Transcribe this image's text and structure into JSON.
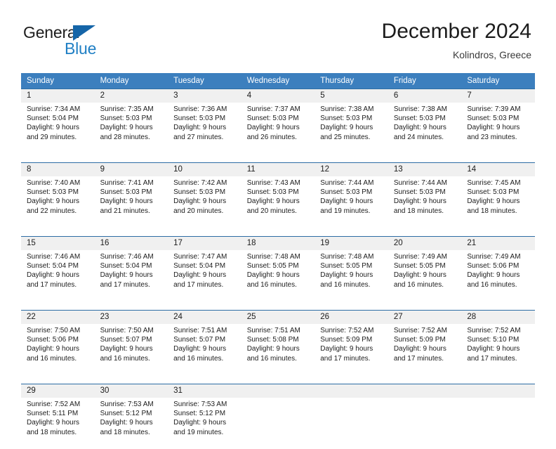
{
  "brand": {
    "name_part1": "General",
    "name_part2": "Blue",
    "triangle_color": "#1565a8",
    "blue_text_color": "#1f7fc4"
  },
  "header": {
    "title": "December 2024",
    "subtitle": "Kolindros, Greece"
  },
  "theme": {
    "header_bg": "#3c7fbe",
    "header_text": "#ffffff",
    "daynum_bg": "#f0f0f0",
    "row_border": "#2d6da4",
    "body_text": "#1c1c1c"
  },
  "weekday_headers": [
    "Sunday",
    "Monday",
    "Tuesday",
    "Wednesday",
    "Thursday",
    "Friday",
    "Saturday"
  ],
  "weeks": [
    {
      "days": [
        {
          "num": "1",
          "sunrise": "Sunrise: 7:34 AM",
          "sunset": "Sunset: 5:04 PM",
          "daylight1": "Daylight: 9 hours",
          "daylight2": "and 29 minutes."
        },
        {
          "num": "2",
          "sunrise": "Sunrise: 7:35 AM",
          "sunset": "Sunset: 5:03 PM",
          "daylight1": "Daylight: 9 hours",
          "daylight2": "and 28 minutes."
        },
        {
          "num": "3",
          "sunrise": "Sunrise: 7:36 AM",
          "sunset": "Sunset: 5:03 PM",
          "daylight1": "Daylight: 9 hours",
          "daylight2": "and 27 minutes."
        },
        {
          "num": "4",
          "sunrise": "Sunrise: 7:37 AM",
          "sunset": "Sunset: 5:03 PM",
          "daylight1": "Daylight: 9 hours",
          "daylight2": "and 26 minutes."
        },
        {
          "num": "5",
          "sunrise": "Sunrise: 7:38 AM",
          "sunset": "Sunset: 5:03 PM",
          "daylight1": "Daylight: 9 hours",
          "daylight2": "and 25 minutes."
        },
        {
          "num": "6",
          "sunrise": "Sunrise: 7:38 AM",
          "sunset": "Sunset: 5:03 PM",
          "daylight1": "Daylight: 9 hours",
          "daylight2": "and 24 minutes."
        },
        {
          "num": "7",
          "sunrise": "Sunrise: 7:39 AM",
          "sunset": "Sunset: 5:03 PM",
          "daylight1": "Daylight: 9 hours",
          "daylight2": "and 23 minutes."
        }
      ]
    },
    {
      "days": [
        {
          "num": "8",
          "sunrise": "Sunrise: 7:40 AM",
          "sunset": "Sunset: 5:03 PM",
          "daylight1": "Daylight: 9 hours",
          "daylight2": "and 22 minutes."
        },
        {
          "num": "9",
          "sunrise": "Sunrise: 7:41 AM",
          "sunset": "Sunset: 5:03 PM",
          "daylight1": "Daylight: 9 hours",
          "daylight2": "and 21 minutes."
        },
        {
          "num": "10",
          "sunrise": "Sunrise: 7:42 AM",
          "sunset": "Sunset: 5:03 PM",
          "daylight1": "Daylight: 9 hours",
          "daylight2": "and 20 minutes."
        },
        {
          "num": "11",
          "sunrise": "Sunrise: 7:43 AM",
          "sunset": "Sunset: 5:03 PM",
          "daylight1": "Daylight: 9 hours",
          "daylight2": "and 20 minutes."
        },
        {
          "num": "12",
          "sunrise": "Sunrise: 7:44 AM",
          "sunset": "Sunset: 5:03 PM",
          "daylight1": "Daylight: 9 hours",
          "daylight2": "and 19 minutes."
        },
        {
          "num": "13",
          "sunrise": "Sunrise: 7:44 AM",
          "sunset": "Sunset: 5:03 PM",
          "daylight1": "Daylight: 9 hours",
          "daylight2": "and 18 minutes."
        },
        {
          "num": "14",
          "sunrise": "Sunrise: 7:45 AM",
          "sunset": "Sunset: 5:03 PM",
          "daylight1": "Daylight: 9 hours",
          "daylight2": "and 18 minutes."
        }
      ]
    },
    {
      "days": [
        {
          "num": "15",
          "sunrise": "Sunrise: 7:46 AM",
          "sunset": "Sunset: 5:04 PM",
          "daylight1": "Daylight: 9 hours",
          "daylight2": "and 17 minutes."
        },
        {
          "num": "16",
          "sunrise": "Sunrise: 7:46 AM",
          "sunset": "Sunset: 5:04 PM",
          "daylight1": "Daylight: 9 hours",
          "daylight2": "and 17 minutes."
        },
        {
          "num": "17",
          "sunrise": "Sunrise: 7:47 AM",
          "sunset": "Sunset: 5:04 PM",
          "daylight1": "Daylight: 9 hours",
          "daylight2": "and 17 minutes."
        },
        {
          "num": "18",
          "sunrise": "Sunrise: 7:48 AM",
          "sunset": "Sunset: 5:05 PM",
          "daylight1": "Daylight: 9 hours",
          "daylight2": "and 16 minutes."
        },
        {
          "num": "19",
          "sunrise": "Sunrise: 7:48 AM",
          "sunset": "Sunset: 5:05 PM",
          "daylight1": "Daylight: 9 hours",
          "daylight2": "and 16 minutes."
        },
        {
          "num": "20",
          "sunrise": "Sunrise: 7:49 AM",
          "sunset": "Sunset: 5:05 PM",
          "daylight1": "Daylight: 9 hours",
          "daylight2": "and 16 minutes."
        },
        {
          "num": "21",
          "sunrise": "Sunrise: 7:49 AM",
          "sunset": "Sunset: 5:06 PM",
          "daylight1": "Daylight: 9 hours",
          "daylight2": "and 16 minutes."
        }
      ]
    },
    {
      "days": [
        {
          "num": "22",
          "sunrise": "Sunrise: 7:50 AM",
          "sunset": "Sunset: 5:06 PM",
          "daylight1": "Daylight: 9 hours",
          "daylight2": "and 16 minutes."
        },
        {
          "num": "23",
          "sunrise": "Sunrise: 7:50 AM",
          "sunset": "Sunset: 5:07 PM",
          "daylight1": "Daylight: 9 hours",
          "daylight2": "and 16 minutes."
        },
        {
          "num": "24",
          "sunrise": "Sunrise: 7:51 AM",
          "sunset": "Sunset: 5:07 PM",
          "daylight1": "Daylight: 9 hours",
          "daylight2": "and 16 minutes."
        },
        {
          "num": "25",
          "sunrise": "Sunrise: 7:51 AM",
          "sunset": "Sunset: 5:08 PM",
          "daylight1": "Daylight: 9 hours",
          "daylight2": "and 16 minutes."
        },
        {
          "num": "26",
          "sunrise": "Sunrise: 7:52 AM",
          "sunset": "Sunset: 5:09 PM",
          "daylight1": "Daylight: 9 hours",
          "daylight2": "and 17 minutes."
        },
        {
          "num": "27",
          "sunrise": "Sunrise: 7:52 AM",
          "sunset": "Sunset: 5:09 PM",
          "daylight1": "Daylight: 9 hours",
          "daylight2": "and 17 minutes."
        },
        {
          "num": "28",
          "sunrise": "Sunrise: 7:52 AM",
          "sunset": "Sunset: 5:10 PM",
          "daylight1": "Daylight: 9 hours",
          "daylight2": "and 17 minutes."
        }
      ]
    },
    {
      "days": [
        {
          "num": "29",
          "sunrise": "Sunrise: 7:52 AM",
          "sunset": "Sunset: 5:11 PM",
          "daylight1": "Daylight: 9 hours",
          "daylight2": "and 18 minutes."
        },
        {
          "num": "30",
          "sunrise": "Sunrise: 7:53 AM",
          "sunset": "Sunset: 5:12 PM",
          "daylight1": "Daylight: 9 hours",
          "daylight2": "and 18 minutes."
        },
        {
          "num": "31",
          "sunrise": "Sunrise: 7:53 AM",
          "sunset": "Sunset: 5:12 PM",
          "daylight1": "Daylight: 9 hours",
          "daylight2": "and 19 minutes."
        },
        {
          "num": "",
          "sunrise": "",
          "sunset": "",
          "daylight1": "",
          "daylight2": ""
        },
        {
          "num": "",
          "sunrise": "",
          "sunset": "",
          "daylight1": "",
          "daylight2": ""
        },
        {
          "num": "",
          "sunrise": "",
          "sunset": "",
          "daylight1": "",
          "daylight2": ""
        },
        {
          "num": "",
          "sunrise": "",
          "sunset": "",
          "daylight1": "",
          "daylight2": ""
        }
      ]
    }
  ]
}
